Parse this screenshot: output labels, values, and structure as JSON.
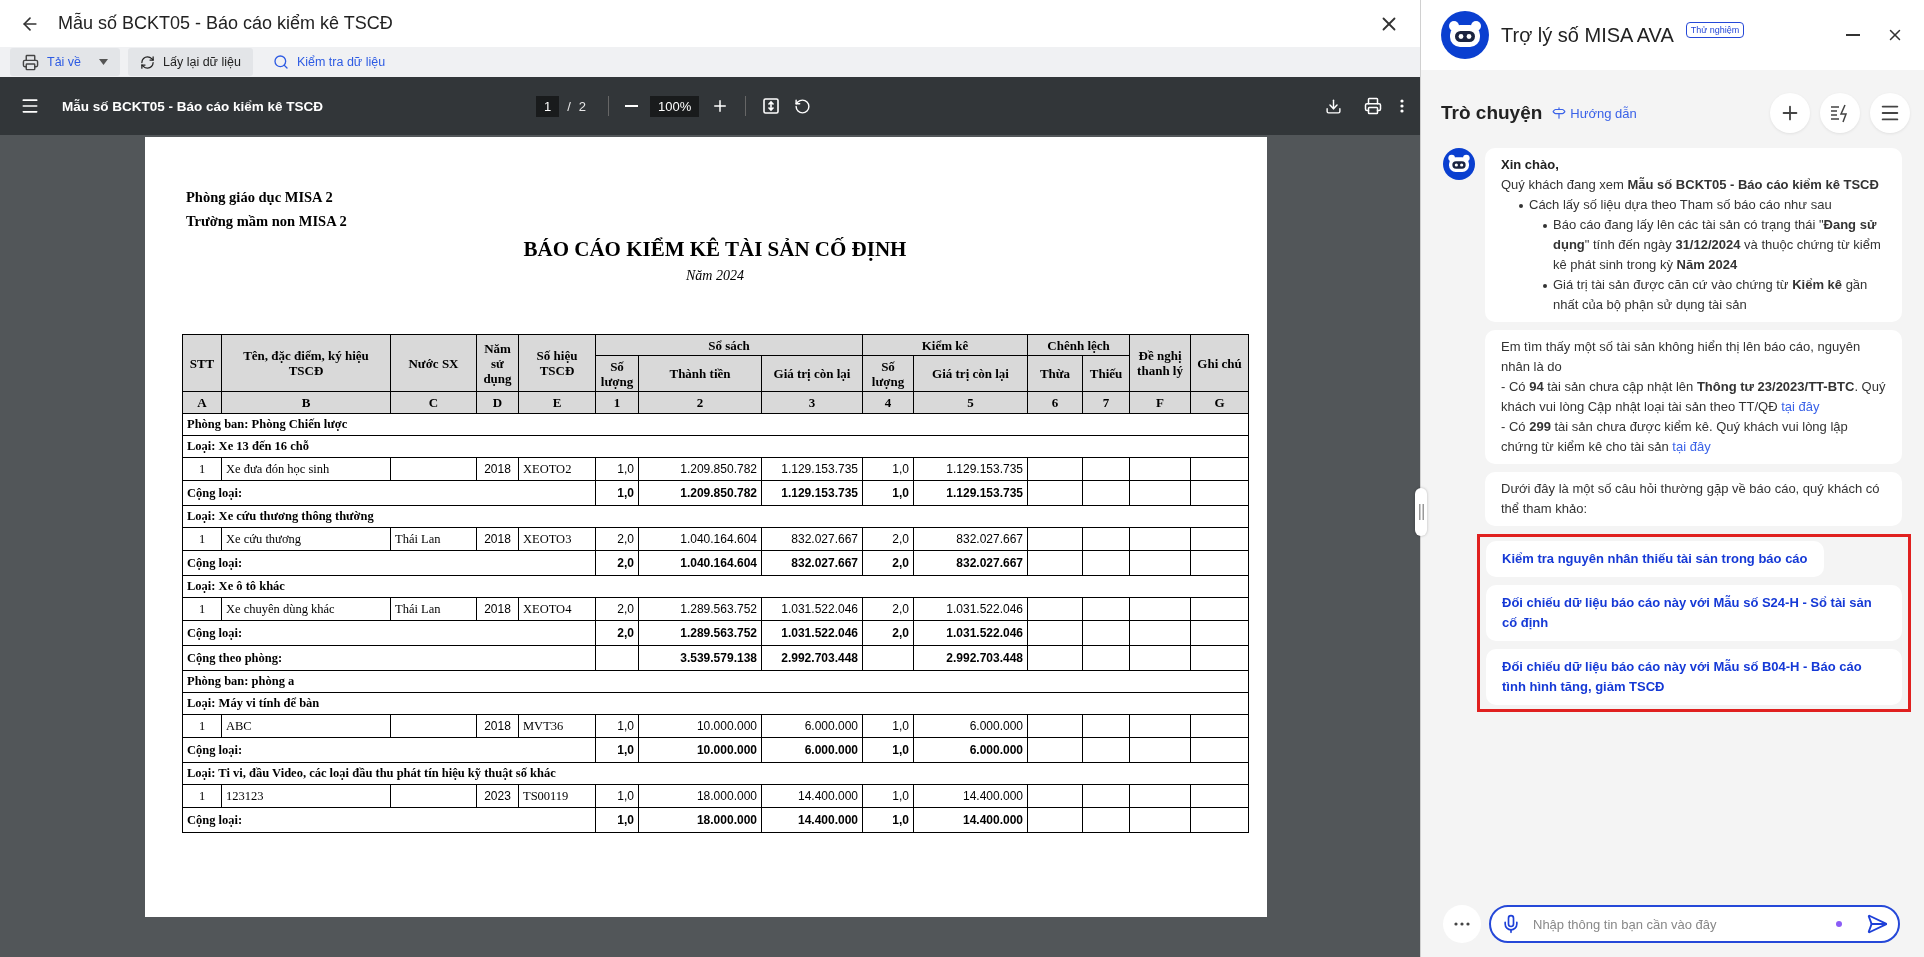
{
  "window": {
    "title": "Mẫu số BCKT05 - Báo cáo kiểm kê TSCĐ"
  },
  "toolbar": [
    {
      "kind": "download",
      "label": "Tải về"
    },
    {
      "kind": "refresh",
      "label": "Lấy lại dữ liệu"
    },
    {
      "kind": "check",
      "label": "Kiểm tra dữ liệu"
    }
  ],
  "pdf_viewer": {
    "title": "Mẫu số BCKT05 - Báo cáo kiểm kê TSCĐ",
    "page": "1",
    "separator": "/",
    "pages": "2",
    "zoom": "100%"
  },
  "report": {
    "org_lines": [
      "Phòng giáo dục MISA 2",
      "Trường mầm non MISA 2"
    ],
    "title": "BÁO CÁO KIỂM KÊ TÀI SẢN CỐ ĐỊNH",
    "subtitle": "Năm 2024",
    "header": [
      {
        "label": "STT",
        "code": "A"
      },
      {
        "label": "Tên, đặc điểm, ký hiệu TSCĐ",
        "code": "B"
      },
      {
        "label": "Nước SX",
        "code": "C"
      },
      {
        "label": "Năm sử dụng",
        "code": "D"
      },
      {
        "label": "Số hiệu TSCĐ",
        "code": "E"
      },
      {
        "label": "Sổ sách",
        "children": [
          {
            "label": "Số lượng",
            "code": "1"
          },
          {
            "label": "Thành tiền",
            "code": "2"
          },
          {
            "label": "Giá trị còn lại",
            "code": "3"
          }
        ]
      },
      {
        "label": "Kiểm kê",
        "children": [
          {
            "label": "Số lượng",
            "code": "4"
          },
          {
            "label": "Giá trị còn lại",
            "code": "5"
          }
        ]
      },
      {
        "label": "Chênh lệch",
        "children": [
          {
            "label": "Thừa",
            "code": "6"
          },
          {
            "label": "Thiếu",
            "code": "7"
          }
        ]
      },
      {
        "label": "Đề nghị thanh lý",
        "code": "F"
      },
      {
        "label": "Ghi chú",
        "code": "G"
      }
    ],
    "rows": [
      {
        "kind": "department",
        "label": "Phòng ban: Phòng Chiến lược"
      },
      {
        "kind": "category",
        "label": "Loại: Xe 13 đến 16 chỗ"
      },
      {
        "kind": "item",
        "stt": "1",
        "name": "Xe đưa đón học sinh",
        "year": "2018",
        "code": "XEOTO2",
        "qty_book": "1,0",
        "amount_book": "1.209.850.782",
        "remaining_book": "1.129.153.735",
        "qty_count": "1,0",
        "remaining_count": "1.129.153.735"
      },
      {
        "kind": "subtotal",
        "label": "Cộng loại:",
        "qty_book": "1,0",
        "amount_book": "1.209.850.782",
        "remaining_book": "1.129.153.735",
        "qty_count": "1,0",
        "remaining_count": "1.129.153.735"
      },
      {
        "kind": "category",
        "label": "Loại: Xe cứu thương thông thường"
      },
      {
        "kind": "item",
        "stt": "1",
        "name": "Xe cứu thương",
        "country": "Thái Lan",
        "year": "2018",
        "code": "XEOTO3",
        "qty_book": "2,0",
        "amount_book": "1.040.164.604",
        "remaining_book": "832.027.667",
        "qty_count": "2,0",
        "remaining_count": "832.027.667"
      },
      {
        "kind": "subtotal",
        "label": "Cộng loại:",
        "qty_book": "2,0",
        "amount_book": "1.040.164.604",
        "remaining_book": "832.027.667",
        "qty_count": "2,0",
        "remaining_count": "832.027.667"
      },
      {
        "kind": "category",
        "label": "Loại: Xe ô tô khác"
      },
      {
        "kind": "item",
        "stt": "1",
        "name": "Xe chuyên dùng khác",
        "country": "Thái Lan",
        "year": "2018",
        "code": "XEOTO4",
        "qty_book": "2,0",
        "amount_book": "1.289.563.752",
        "remaining_book": "1.031.522.046",
        "qty_count": "2,0",
        "remaining_count": "1.031.522.046"
      },
      {
        "kind": "subtotal",
        "label": "Cộng loại:",
        "qty_book": "2,0",
        "amount_book": "1.289.563.752",
        "remaining_book": "1.031.522.046",
        "qty_count": "2,0",
        "remaining_count": "1.031.522.046"
      },
      {
        "kind": "department_total",
        "label": "Cộng theo phòng:",
        "amount_book": "3.539.579.138",
        "remaining_book": "2.992.703.448",
        "remaining_count": "2.992.703.448"
      },
      {
        "kind": "department",
        "label": "Phòng ban: phòng a"
      },
      {
        "kind": "category",
        "label": "Loại: Máy vi tính để bàn"
      },
      {
        "kind": "item",
        "stt": "1",
        "name": "ABC",
        "year": "2018",
        "code": "MVT36",
        "qty_book": "1,0",
        "amount_book": "10.000.000",
        "remaining_book": "6.000.000",
        "qty_count": "1,0",
        "remaining_count": "6.000.000"
      },
      {
        "kind": "subtotal",
        "label": "Cộng loại:",
        "qty_book": "1,0",
        "amount_book": "10.000.000",
        "remaining_book": "6.000.000",
        "qty_count": "1,0",
        "remaining_count": "6.000.000"
      },
      {
        "kind": "category",
        "label": "Loại: Ti vi, đầu Video, các loại đầu thu phát tín hiệu kỹ thuật số khác"
      },
      {
        "kind": "item",
        "stt": "1",
        "name": "123123",
        "year": "2023",
        "code": "TS00119",
        "qty_book": "1,0",
        "amount_book": "18.000.000",
        "remaining_book": "14.400.000",
        "qty_count": "1,0",
        "remaining_count": "14.400.000"
      },
      {
        "kind": "subtotal",
        "label": "Cộng loại:",
        "qty_book": "1,0",
        "amount_book": "18.000.000",
        "remaining_book": "14.400.000",
        "qty_count": "1,0",
        "remaining_count": "14.400.000"
      }
    ]
  },
  "assistant": {
    "title": "Trợ lý số MISA AVA",
    "badge": "Thử nghiệm",
    "section_title": "Trò chuyện",
    "guide_link": "Hướng dẫn",
    "messages": [
      {
        "avatar": true,
        "blocks": [
          {
            "kind": "greeting",
            "text": "Xin chào,"
          },
          {
            "kind": "text",
            "text": "Quý khách đang xem **Mẫu số BCKT05 - Báo cáo kiểm kê TSCĐ**"
          },
          {
            "kind": "bullet",
            "text": "Cách lấy số liệu dựa theo Tham số báo cáo như sau",
            "children": [
              {
                "text": "Báo cáo đang lấy lên các tài sản có trạng thái \"**Đang sử dụng**\" tính đến ngày **31/12/2024** và thuộc chứng từ kiểm kê phát sinh trong kỳ **Năm 2024**"
              },
              {
                "text": "Giá trị tài sản được căn cứ vào chứng từ **Kiểm kê** gần nhất của bộ phận sử dụng tài sản"
              }
            ]
          }
        ]
      },
      {
        "avatar": false,
        "blocks": [
          {
            "kind": "text",
            "text": "Em tìm thấy một số tài sản không hiển thị lên báo cáo, nguyên nhân là do"
          },
          {
            "kind": "text",
            "text": "- Có **94** tài sản chưa cập nhật lên **Thông tư 23/2023/TT-BTC**. Quý khách vui lòng Cập nhật loại tài sản theo TT/QĐ",
            "link": "tại đây"
          },
          {
            "kind": "text",
            "text": "- Có **299** tài sản chưa được kiểm kê. Quý khách vui lòng lập chứng từ kiểm kê cho tài sản",
            "link": "tại đây"
          }
        ]
      },
      {
        "avatar": false,
        "blocks": [
          {
            "kind": "text",
            "text": "Dưới đây là một số câu hỏi thường gặp về báo cáo, quý khách có thể tham khảo:"
          }
        ]
      }
    ],
    "suggestions_highlighted": true,
    "suggestions": [
      "Kiểm tra nguyên nhân thiếu tài sản trong báo cáo",
      "Đối chiếu dữ liệu báo cáo này với Mẫu số S24-H - Sổ tài sản cố định",
      "Đối chiếu dữ liệu báo cáo này với Mẫu số B04-H - Báo cáo tình hình tăng, giảm TSCĐ"
    ],
    "input": {
      "placeholder": "Nhập thông tin bạn cần vào đây"
    }
  }
}
